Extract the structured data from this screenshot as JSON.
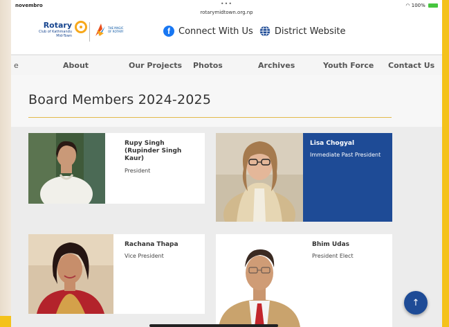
{
  "status": {
    "left": "novembro",
    "dots": "•••",
    "url": "rotarymidtown.org.np",
    "right": "100%"
  },
  "brand": {
    "rotary_word": "Rotary",
    "club_line1": "Club of Kathmandu",
    "club_line2": "Mid-Town",
    "magic_text_1": "THE MAGIC",
    "magic_text_2": "OF ROTARY"
  },
  "social": {
    "connect_label": "Connect With Us",
    "district_label": "District Website"
  },
  "nav": {
    "partial": "e",
    "items": [
      {
        "label": "About"
      },
      {
        "label": "Our Projects"
      },
      {
        "label": "Photos"
      },
      {
        "label": "Archives"
      },
      {
        "label": "Youth Force"
      },
      {
        "label": "Contact Us"
      }
    ]
  },
  "page": {
    "title": "Board Members 2024-2025"
  },
  "members": [
    {
      "name": "Rupy Singh (Rupinder Singh Kaur)",
      "role": "President"
    },
    {
      "name": "Lisa Chogyal",
      "role": "Immediate Past President"
    },
    {
      "name": "Rachana Thapa",
      "role": "Vice President"
    },
    {
      "name": "Bhim Udas",
      "role": "President Elect"
    }
  ],
  "colors": {
    "frame": "#f4c21a",
    "rotary_blue": "#1e4b96",
    "rotary_gold": "#f7a81b",
    "divider_gold": "#e3b94a"
  },
  "icons": {
    "facebook": "facebook-icon",
    "globe": "globe-icon",
    "scroll_top": "arrow-up-icon"
  }
}
